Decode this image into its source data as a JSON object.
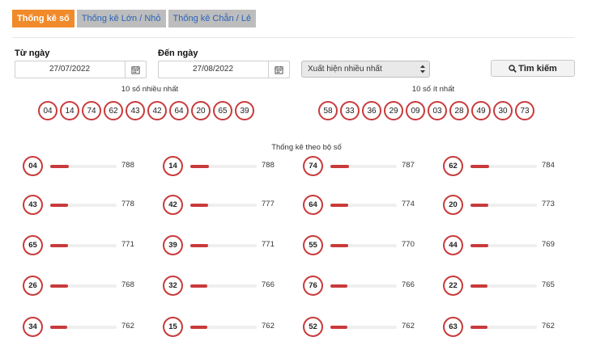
{
  "tabs": [
    {
      "label": "Thống kê số",
      "active": true
    },
    {
      "label": "Thống kê Lớn / Nhỏ",
      "active": false
    },
    {
      "label": "Thống kê Chẵn / Lẻ",
      "active": false
    }
  ],
  "form": {
    "from_label": "Từ ngày",
    "from_value": "27/07/2022",
    "to_label": "Đến ngày",
    "to_value": "27/08/2022",
    "mode_selected": "Xuất hiện nhiều nhất",
    "search_label": "Tìm kiếm"
  },
  "top": {
    "most_title": "10 số nhiều nhất",
    "most": [
      "04",
      "14",
      "74",
      "62",
      "43",
      "42",
      "64",
      "20",
      "65",
      "39"
    ],
    "least_title": "10 số ít nhất",
    "least": [
      "58",
      "33",
      "36",
      "29",
      "09",
      "03",
      "28",
      "49",
      "30",
      "73"
    ]
  },
  "stats_title": "Thống kê theo bộ số",
  "stats": [
    {
      "num": "04",
      "count": "788",
      "level": 0.28
    },
    {
      "num": "14",
      "count": "788",
      "level": 0.28
    },
    {
      "num": "74",
      "count": "787",
      "level": 0.28
    },
    {
      "num": "62",
      "count": "784",
      "level": 0.28
    },
    {
      "num": "43",
      "count": "778",
      "level": 0.27
    },
    {
      "num": "42",
      "count": "777",
      "level": 0.27
    },
    {
      "num": "64",
      "count": "774",
      "level": 0.27
    },
    {
      "num": "20",
      "count": "773",
      "level": 0.27
    },
    {
      "num": "65",
      "count": "771",
      "level": 0.27
    },
    {
      "num": "39",
      "count": "771",
      "level": 0.27
    },
    {
      "num": "55",
      "count": "770",
      "level": 0.27
    },
    {
      "num": "44",
      "count": "769",
      "level": 0.27
    },
    {
      "num": "26",
      "count": "768",
      "level": 0.27
    },
    {
      "num": "32",
      "count": "766",
      "level": 0.26
    },
    {
      "num": "76",
      "count": "766",
      "level": 0.26
    },
    {
      "num": "22",
      "count": "765",
      "level": 0.26
    },
    {
      "num": "34",
      "count": "762",
      "level": 0.26
    },
    {
      "num": "15",
      "count": "762",
      "level": 0.26
    },
    {
      "num": "52",
      "count": "762",
      "level": 0.26
    },
    {
      "num": "63",
      "count": "762",
      "level": 0.26
    }
  ],
  "colors": {
    "accent": "#f08a2a",
    "ball_border": "#c93a3a",
    "tab_inactive": "#bdbdbd",
    "tab_link": "#2a63b7"
  },
  "icons": {
    "calendar": "calendar-icon",
    "search": "search-icon",
    "select": "select-arrows-icon"
  }
}
